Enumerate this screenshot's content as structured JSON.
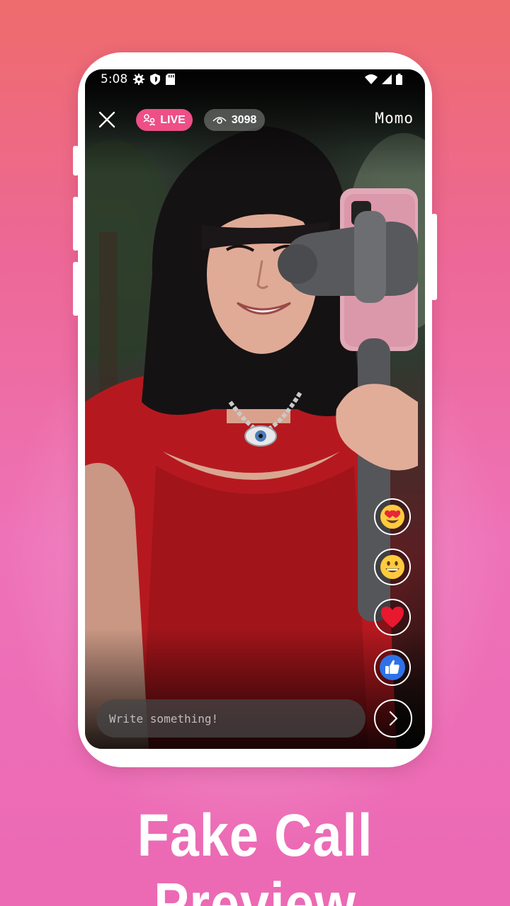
{
  "status_bar": {
    "time": "5:08",
    "left_icons": [
      "gear-icon",
      "shield-icon",
      "sd-card-icon"
    ],
    "right_icons": [
      "wifi-icon",
      "signal-icon",
      "battery-icon"
    ]
  },
  "live_stream": {
    "live_label": "LIVE",
    "viewer_count": "3098",
    "host_name": "Momo",
    "reactions": [
      "heart-eyes-emoji",
      "grinning-emoji",
      "red-heart-emoji",
      "thumbs-up-emoji"
    ],
    "comment_placeholder": "Write something!"
  },
  "headline": "Fake Call Preview",
  "colors": {
    "live_badge": "#ee4f86",
    "background_top": "#ee6c6c",
    "background_bottom": "#ec69b4",
    "like_blue": "#2f72e8"
  }
}
